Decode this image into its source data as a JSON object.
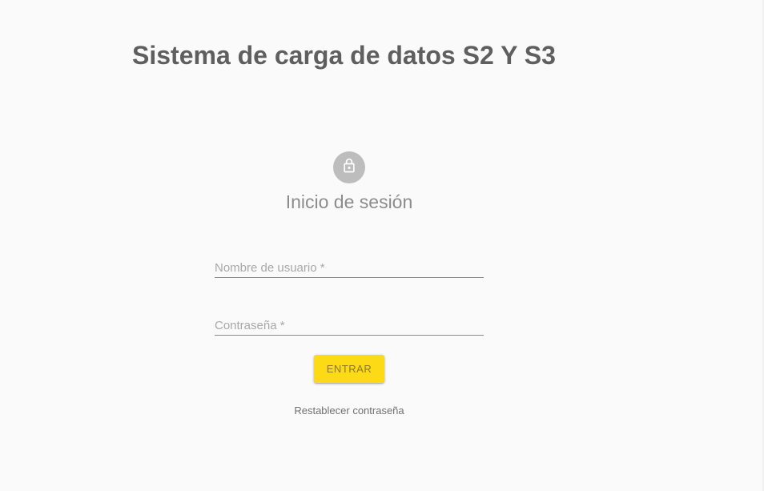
{
  "header": {
    "title": "Sistema de carga de datos S2 Y S3"
  },
  "login": {
    "icon": "lock-icon",
    "heading": "Inicio de sesión",
    "username_placeholder": "Nombre de usuario *",
    "password_placeholder": "Contraseña *",
    "submit_label": "ENTRAR",
    "reset_label": "Restablecer contraseña"
  },
  "colors": {
    "background": "#fafafa",
    "title": "#5f5f5f",
    "avatar": "#bdbdbd",
    "button": "#fcda15",
    "underline": "#8a8a8a"
  }
}
